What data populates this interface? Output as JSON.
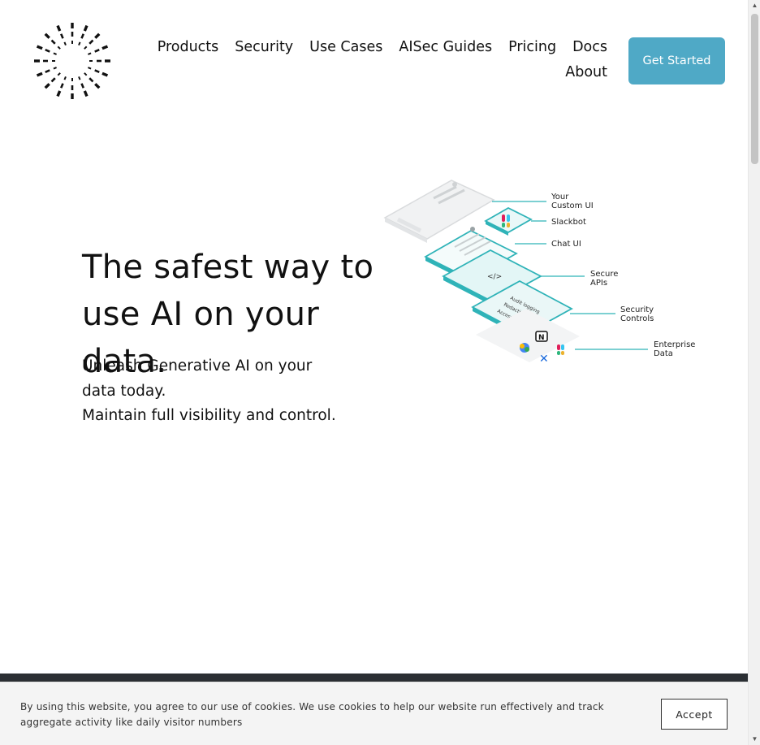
{
  "nav": {
    "items_row1": [
      "Products",
      "Security",
      "Use Cases",
      "AISec Guides",
      "Pricing",
      "Docs"
    ],
    "items_row2": [
      "About"
    ],
    "cta_label": "Get Started"
  },
  "hero": {
    "title": "The safest way to use AI on your data.",
    "subtitle_line1": "Unleash Generative AI on your data today.",
    "subtitle_line2": "Maintain full visibility and control."
  },
  "diagram": {
    "labels": [
      "Your Custom UI",
      "Slackbot",
      "Chat UI",
      "Secure APIs",
      "Security Controls",
      "Enterprise Data"
    ],
    "control_items": [
      "Audit logging",
      "Redaction",
      "Access Controls"
    ],
    "accent_color": "#2fb3b8"
  },
  "cookie": {
    "text": "By using this website, you agree to our use of cookies. We use cookies to help our website run effectively and  track aggregate activity like daily visitor numbers",
    "accept_label": "Accept"
  },
  "colors": {
    "cta": "#4fa9c6",
    "band": "#2b2f33",
    "cookie_bg": "#f4f4f4"
  }
}
